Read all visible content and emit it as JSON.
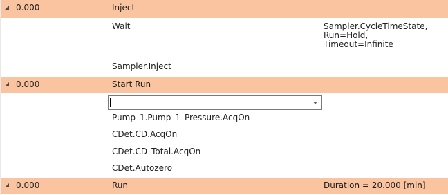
{
  "rows": [
    {
      "kind": "step",
      "time": "0.000",
      "name": "Inject",
      "detail": ""
    },
    {
      "kind": "cmd",
      "name": "Wait",
      "detail": "Sampler.CycleTimeState,\nRun=Hold,\nTimeout=Infinite"
    },
    {
      "kind": "cmd",
      "name": "Sampler.Inject",
      "detail": ""
    },
    {
      "kind": "step",
      "time": "0.000",
      "name": "Start Run",
      "detail": ""
    },
    {
      "kind": "edit",
      "value": ""
    },
    {
      "kind": "cmd",
      "name": "Pump_1.Pump_1_Pressure.AcqOn",
      "detail": ""
    },
    {
      "kind": "cmd",
      "name": "CDet.CD.AcqOn",
      "detail": ""
    },
    {
      "kind": "cmd",
      "name": "CDet.CD_Total.AcqOn",
      "detail": ""
    },
    {
      "kind": "cmd",
      "name": "CDet.Autozero",
      "detail": ""
    },
    {
      "kind": "step",
      "time": "0.000",
      "name": "Run",
      "detail": "Duration = 20.000 [min]"
    }
  ]
}
